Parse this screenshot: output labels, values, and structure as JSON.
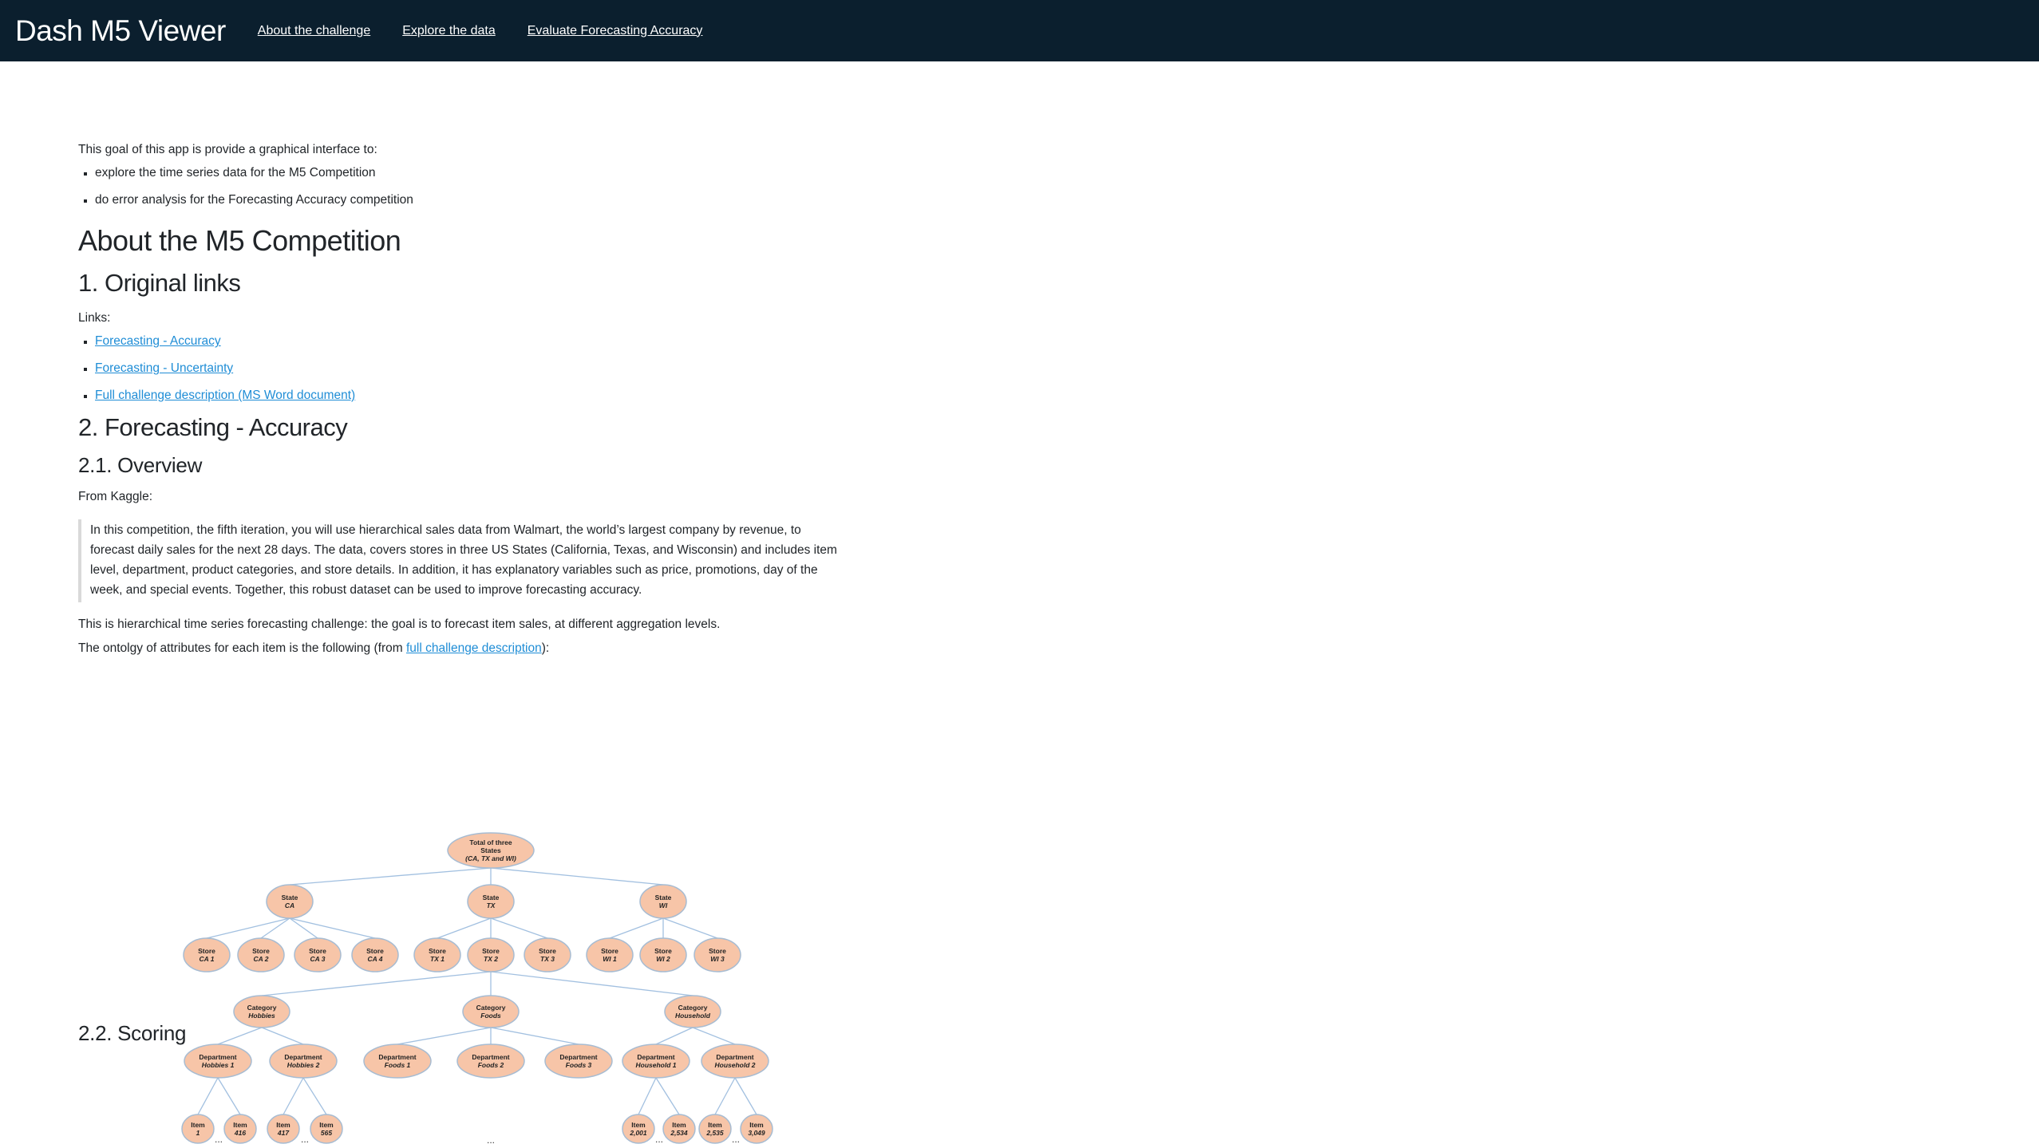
{
  "navbar": {
    "brand": "Dash M5 Viewer",
    "links": [
      "About the challenge",
      "Explore the data",
      "Evaluate Forecasting Accuracy"
    ]
  },
  "intro": {
    "text": "This goal of this app is provide a graphical interface to:",
    "bullets": [
      "explore the time series data for the M5 Competition",
      "do error analysis for the Forecasting Accuracy competition"
    ]
  },
  "h1": "About the M5 Competition",
  "section1": {
    "title": "1. Original links",
    "links_label": "Links:",
    "links": [
      "Forecasting - Accuracy",
      "Forecasting - Uncertainty",
      "Full challenge description (MS Word document)"
    ]
  },
  "section2": {
    "title": "2. Forecasting - Accuracy",
    "overview_title": "2.1. Overview",
    "from": "From Kaggle:",
    "quote": "In this competition, the fifth iteration, you will use hierarchical sales data from Walmart, the world’s largest company by revenue, to forecast daily sales for the next 28 days. The data, covers stores in three US States (California, Texas, and Wisconsin) and includes item level, department, product categories, and store details. In addition, it has explanatory variables such as price, promotions, day of the week, and special events. Together, this robust dataset can be used to improve forecasting accuracy.",
    "para1": "This is hierarchical time series forecasting challenge: the goal is to forecast item sales, at different aggregation levels.",
    "para2_prefix": "The ontolgy of attributes for each item is the following (from ",
    "para2_link": "full challenge description",
    "para2_suffix": "):",
    "scoring_title": "2.2. Scoring"
  },
  "diagram": {
    "root": [
      "Total of three",
      "States",
      "(CA, TX and WI)"
    ],
    "states": [
      [
        "State",
        "CA"
      ],
      [
        "State",
        "TX"
      ],
      [
        "State",
        "WI"
      ]
    ],
    "stores": [
      [
        "Store",
        "CA 1"
      ],
      [
        "Store",
        "CA 2"
      ],
      [
        "Store",
        "CA 3"
      ],
      [
        "Store",
        "CA 4"
      ],
      [
        "Store",
        "TX 1"
      ],
      [
        "Store",
        "TX 2"
      ],
      [
        "Store",
        "TX 3"
      ],
      [
        "Store",
        "WI 1"
      ],
      [
        "Store",
        "WI 2"
      ],
      [
        "Store",
        "WI 3"
      ]
    ],
    "categories": [
      [
        "Category",
        "Hobbies"
      ],
      [
        "Category",
        "Foods"
      ],
      [
        "Category",
        "Household"
      ]
    ],
    "departments": [
      [
        "Department",
        "Hobbies 1"
      ],
      [
        "Department",
        "Hobbies 2"
      ],
      [
        "Department",
        "Foods 1"
      ],
      [
        "Department",
        "Foods 2"
      ],
      [
        "Department",
        "Foods 3"
      ],
      [
        "Department",
        "Household 1"
      ],
      [
        "Department",
        "Household 2"
      ]
    ],
    "items": [
      [
        "Item",
        "1"
      ],
      [
        "Item",
        "416"
      ],
      [
        "Item",
        "417"
      ],
      [
        "Item",
        "565"
      ],
      [
        "Item",
        "2,001"
      ],
      [
        "Item",
        "2,534"
      ],
      [
        "Item",
        "2,535"
      ],
      [
        "Item",
        "3,049"
      ]
    ],
    "ellipsis": "..."
  }
}
